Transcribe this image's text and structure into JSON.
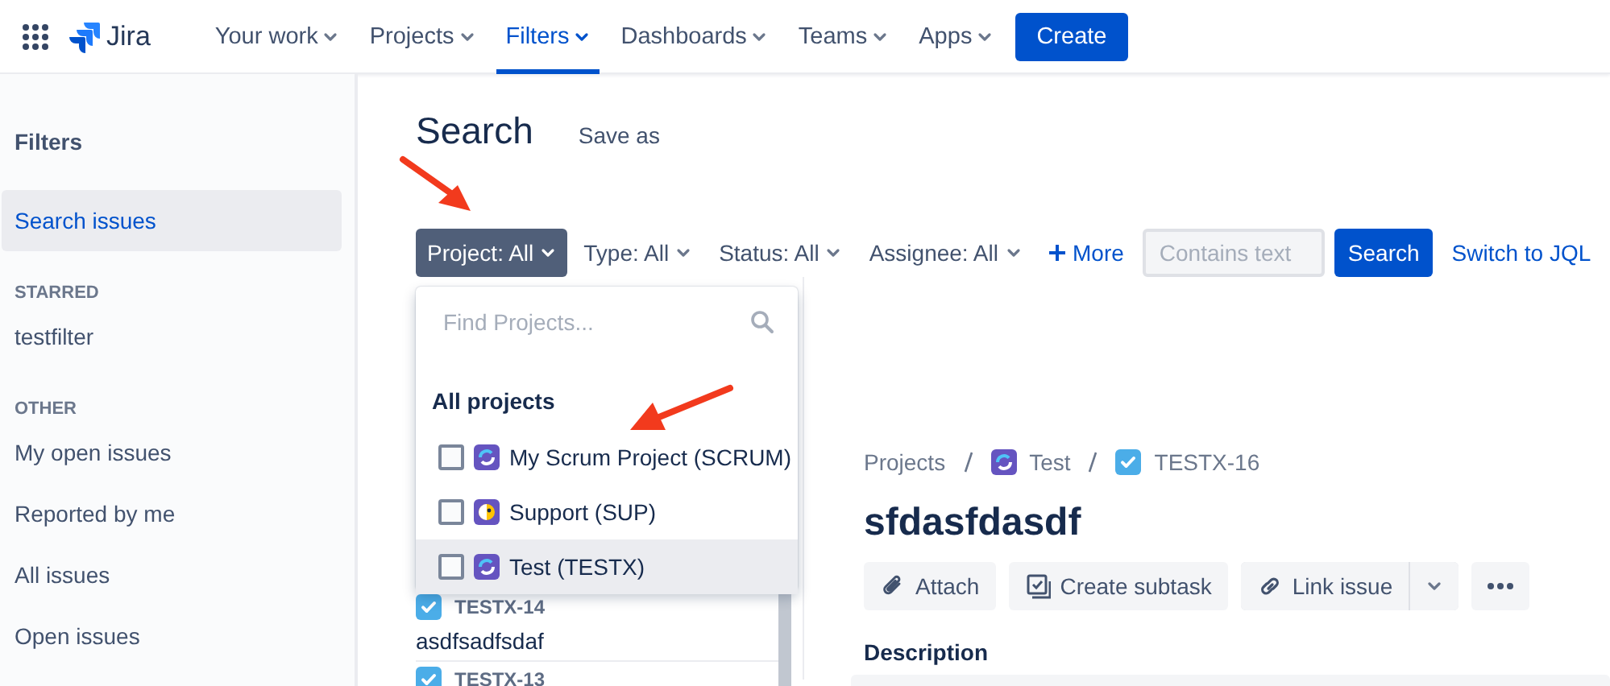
{
  "app": {
    "name": "Jira"
  },
  "nav": [
    {
      "label": "Your work",
      "selected": false
    },
    {
      "label": "Projects",
      "selected": false
    },
    {
      "label": "Filters",
      "selected": true
    },
    {
      "label": "Dashboards",
      "selected": false
    },
    {
      "label": "Teams",
      "selected": false
    },
    {
      "label": "Apps",
      "selected": false
    }
  ],
  "create_button": "Create",
  "sidebar": {
    "title": "Filters",
    "groups": [
      {
        "items": [
          {
            "label": "Search issues",
            "selected": true
          }
        ]
      },
      {
        "heading": "STARRED",
        "items": [
          {
            "label": "testfilter",
            "selected": false
          }
        ]
      },
      {
        "heading": "OTHER",
        "items": [
          {
            "label": "My open issues",
            "selected": false
          },
          {
            "label": "Reported by me",
            "selected": false
          },
          {
            "label": "All issues",
            "selected": false
          },
          {
            "label": "Open issues",
            "selected": false
          }
        ]
      }
    ]
  },
  "page": {
    "title": "Search",
    "save_as": "Save as"
  },
  "filters": [
    {
      "label": "Project: All",
      "open": true
    },
    {
      "label": "Type: All",
      "open": false
    },
    {
      "label": "Status: All",
      "open": false
    },
    {
      "label": "Assignee: All",
      "open": false
    }
  ],
  "more_button": "More",
  "text_search": {
    "placeholder": "Contains text"
  },
  "search_button": "Search",
  "switch_link": "Switch to JQL",
  "project_dropdown": {
    "placeholder": "Find Projects...",
    "heading": "All projects",
    "projects": [
      {
        "name": "My Scrum Project (SCRUM)",
        "checked": false,
        "highlighted": false
      },
      {
        "name": "Support (SUP)",
        "checked": false,
        "highlighted": false
      },
      {
        "name": "Test (TESTX)",
        "checked": false,
        "highlighted": true
      }
    ]
  },
  "issue_list": [
    {
      "key": "TESTX-14",
      "summary": "asdfsadfsdaf"
    },
    {
      "key": "TESTX-13"
    }
  ],
  "issue": {
    "breadcrumbs": [
      {
        "label": "Projects",
        "kind": "link"
      },
      {
        "label": "Test",
        "kind": "project"
      },
      {
        "label": "TESTX-16",
        "kind": "issue"
      }
    ],
    "title": "sfdasfdasdf",
    "actions": [
      {
        "label": "Attach"
      },
      {
        "label": "Create subtask"
      },
      {
        "label": "Link issue"
      }
    ],
    "description_heading": "Description"
  },
  "annotations": [
    {
      "kind": "arrow"
    },
    {
      "kind": "arrow"
    }
  ]
}
